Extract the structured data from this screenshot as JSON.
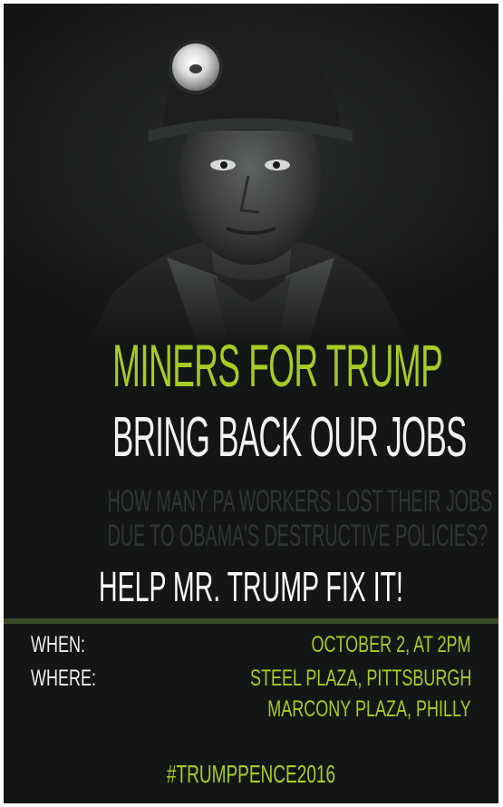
{
  "poster": {
    "headline": "MINERS FOR TRUMP",
    "subhead": "BRING BACK OUR JOBS",
    "faded_question": [
      "HOW MANY PA WORKERS LOST THEIR JOBS",
      "DUE TO OBAMA'S DESTRUCTIVE POLICIES?"
    ],
    "call_to_action": "HELP MR. TRUMP FIX IT!",
    "details": {
      "when_label": "WHEN:",
      "when_value": "OCTOBER 2, AT 2PM",
      "where_label": "WHERE:",
      "where_values": [
        "STEEL PLAZA, PITTSBURGH",
        "MARCONY PLAZA, PHILLY"
      ]
    },
    "hashtag": "#TRUMPPENCE2016"
  },
  "colors": {
    "background": "#141616",
    "accent_green": "#a6cc24",
    "white": "#f2f2f2",
    "faded_text": "#2f3536"
  }
}
